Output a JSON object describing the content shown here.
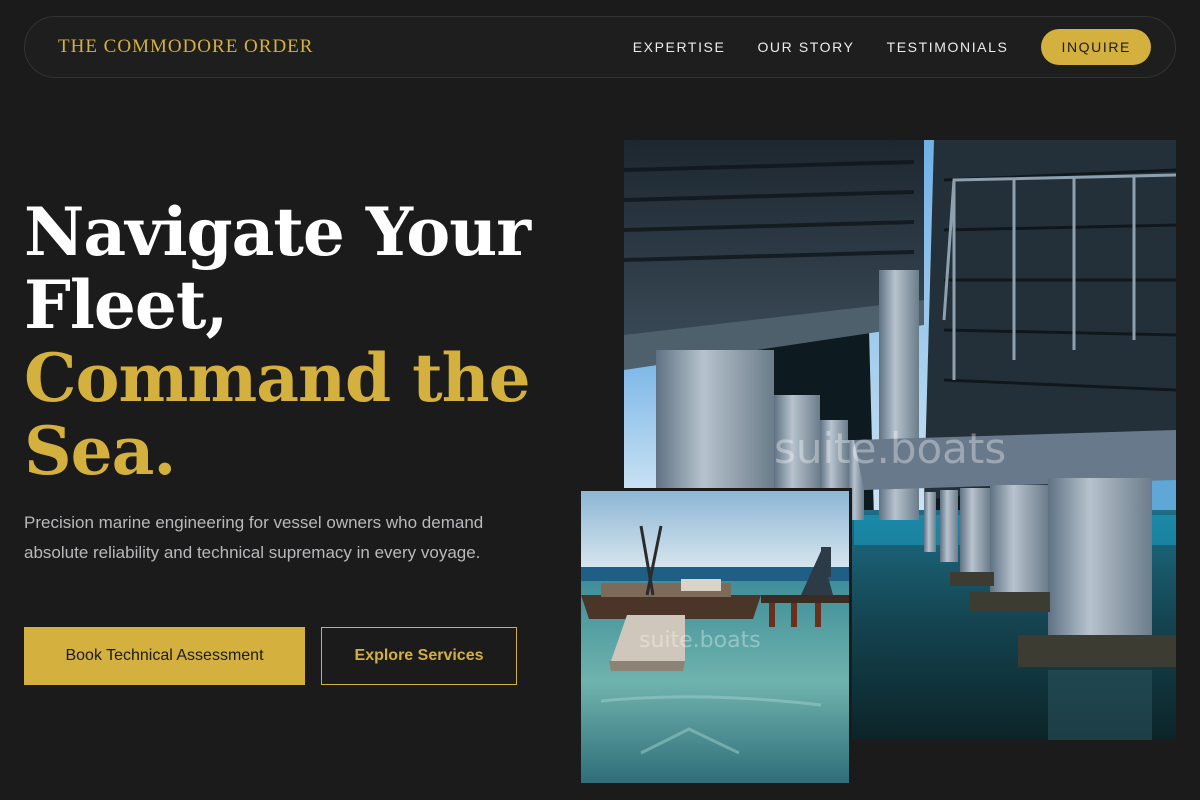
{
  "nav": {
    "brand": "THE COMMODORE ORDER",
    "links": [
      "EXPERTISE",
      "OUR STORY",
      "TESTIMONIALS"
    ],
    "cta": "INQUIRE"
  },
  "hero": {
    "title_line1": "Navigate Your",
    "title_line2": "Fleet,",
    "title_line3": "Command the",
    "title_line4": "Sea.",
    "subtitle": "Precision marine engineering for vessel owners who demand absolute reliability and technical supremacy in every voyage.",
    "primary_button": "Book Technical Assessment",
    "secondary_button": "Explore Services"
  },
  "images": {
    "main_watermark": "suite.boats",
    "inset_watermark": "suite.boats"
  },
  "colors": {
    "background": "#1b1b1b",
    "accent": "#d4b03e",
    "text": "#ffffff",
    "muted": "#b9b9bd"
  }
}
